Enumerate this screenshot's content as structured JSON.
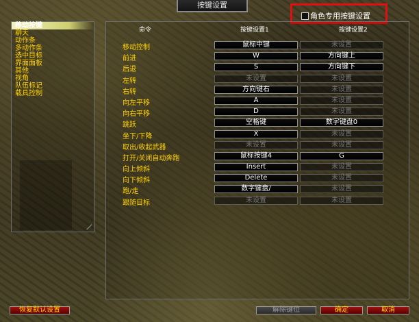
{
  "window": {
    "title": "按键设置"
  },
  "character_specific": {
    "label": "角色专用按键设置",
    "checked": false
  },
  "sidebar": {
    "items": [
      {
        "label": "移动按键",
        "active": true
      },
      {
        "label": "聊天",
        "active": false
      },
      {
        "label": "动作条",
        "active": false
      },
      {
        "label": "多动作条",
        "active": false
      },
      {
        "label": "选中目标",
        "active": false
      },
      {
        "label": "界面面板",
        "active": false
      },
      {
        "label": "其他",
        "active": false
      },
      {
        "label": "视角",
        "active": false
      },
      {
        "label": "队伍标记",
        "active": false
      },
      {
        "label": "载具控制",
        "active": false
      }
    ]
  },
  "table": {
    "headers": {
      "command": "命令",
      "binding1": "按键设置1",
      "binding2": "按键设置2"
    },
    "rows": [
      {
        "command": "移动控制",
        "key1": "鼠标中键",
        "key2": "未设置"
      },
      {
        "command": "前进",
        "key1": "W",
        "key2": "方向键上"
      },
      {
        "command": "后退",
        "key1": "S",
        "key2": "方向键下"
      },
      {
        "command": "左转",
        "key1": "未设置",
        "key2": "未设置"
      },
      {
        "command": "右转",
        "key1": "方向键右",
        "key2": "未设置"
      },
      {
        "command": "向左平移",
        "key1": "A",
        "key2": "未设置"
      },
      {
        "command": "向右平移",
        "key1": "D",
        "key2": "未设置"
      },
      {
        "command": "跳跃",
        "key1": "空格键",
        "key2": "数字键盘0"
      },
      {
        "command": "坐下/下降",
        "key1": "X",
        "key2": "未设置"
      },
      {
        "command": "取出/收起武器",
        "key1": "未设置",
        "key2": "未设置"
      },
      {
        "command": "打开/关闭自动奔跑",
        "key1": "鼠标按键4",
        "key2": "G"
      },
      {
        "command": "向上倾斜",
        "key1": "Insert",
        "key2": "未设置"
      },
      {
        "command": "向下倾斜",
        "key1": "Delete",
        "key2": "未设置"
      },
      {
        "command": "跑/走",
        "key1": "数字键盘/",
        "key2": "未设置"
      },
      {
        "command": "跟随目标",
        "key1": "未设置",
        "key2": "未设置"
      }
    ]
  },
  "footer": {
    "reset_label": "恢复默认设置",
    "unbind_label": "解除键位",
    "ok_label": "确定",
    "cancel_label": "取消"
  }
}
